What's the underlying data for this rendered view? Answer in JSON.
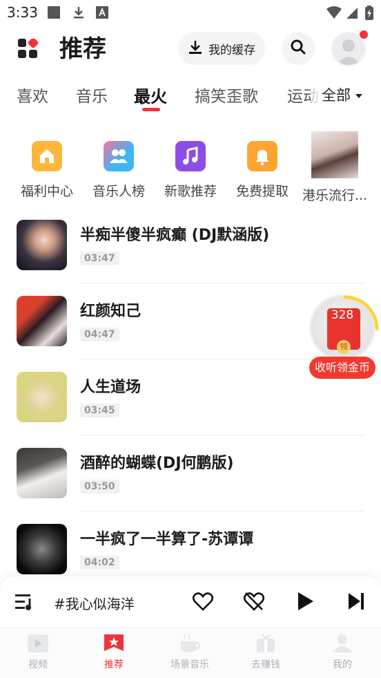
{
  "status_bar": {
    "time": "3:33"
  },
  "header": {
    "title": "推荐",
    "cache_label": "我的缓存"
  },
  "tabs": {
    "items": [
      "喜欢",
      "音乐",
      "最火",
      "搞笑歪歌",
      "运动"
    ],
    "active": "最火",
    "all_label": "全部"
  },
  "quick_entries": [
    {
      "label": "福利中心",
      "icon": "home-icon",
      "color": "#ffb63d"
    },
    {
      "label": "音乐人榜",
      "icon": "people-icon",
      "color": "#3cb7f4"
    },
    {
      "label": "新歌推荐",
      "icon": "music-note-icon",
      "color": "#8e4ee6"
    },
    {
      "label": "免费提取",
      "icon": "bell-icon",
      "color": "#ffa42f"
    },
    {
      "label": "港乐流行...",
      "icon": "photo-thumbnail"
    }
  ],
  "songs": [
    {
      "title": "半痴半傻半疯癫 (DJ默涵版)",
      "duration": "03:47"
    },
    {
      "title": "红颜知己",
      "duration": "04:47"
    },
    {
      "title": "人生道场",
      "duration": "03:45"
    },
    {
      "title": "酒醉的蝴蝶(DJ何鹏版)",
      "duration": "03:50"
    },
    {
      "title": "一半疯了一半算了-苏谭谭",
      "duration": "04:02"
    }
  ],
  "coin_badge": {
    "amount": "328",
    "button": "领",
    "label": "收听领金币"
  },
  "player": {
    "now_playing": "#我心似海洋"
  },
  "bottom_nav": [
    {
      "label": "视频",
      "icon": "video-icon"
    },
    {
      "label": "推荐",
      "icon": "recommend-icon",
      "active": true
    },
    {
      "label": "场景音乐",
      "icon": "coffee-cup-icon"
    },
    {
      "label": "去赚钱",
      "icon": "gift-icon"
    },
    {
      "label": "我的",
      "icon": "profile-icon"
    }
  ],
  "colors": {
    "accent": "#f0323a",
    "tab_inactive": "#555555"
  }
}
